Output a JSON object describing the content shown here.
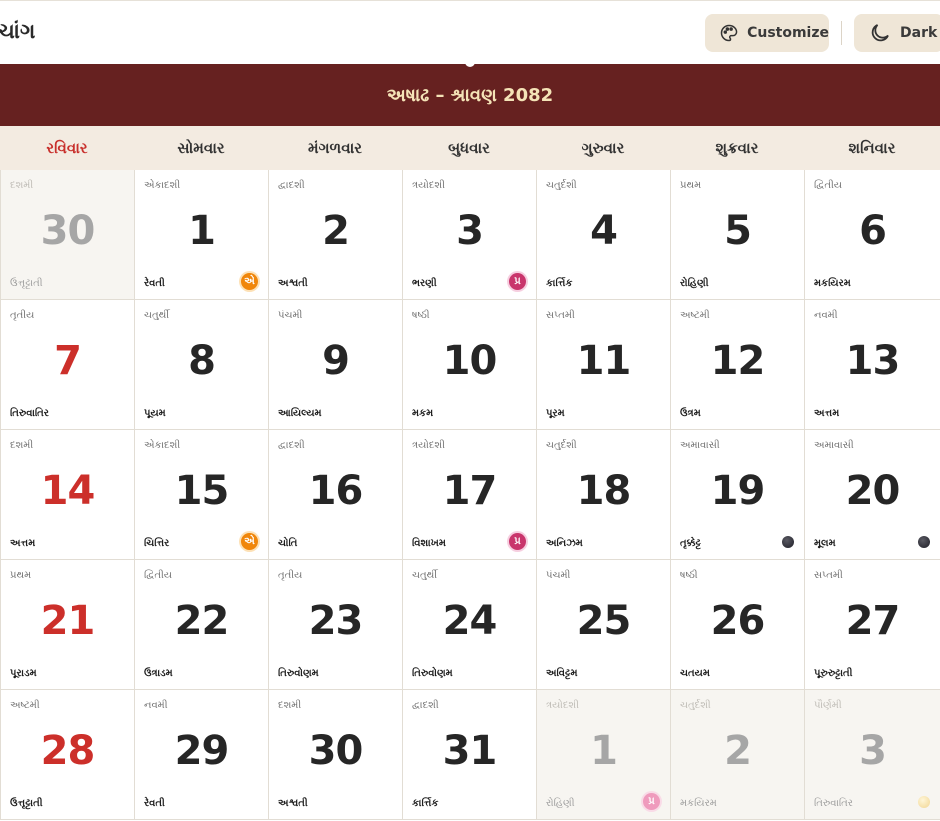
{
  "header": {
    "title": "ચાંગ",
    "customize_label": "Customize",
    "dark_label": "Dark"
  },
  "month": {
    "title": "અષાઢ – શ્રાવણ 2082"
  },
  "weekdays": [
    "રવિવાર",
    "સોમવાર",
    "મંગળવાર",
    "બુધવાર",
    "ગુરુવાર",
    "શુક્રવાર",
    "શનિવાર"
  ],
  "weeks": [
    [
      {
        "day": "30",
        "tithi": "દશમી",
        "nakshatra": "ઉત્તૃટ્ટાતી",
        "muted": true
      },
      {
        "day": "1",
        "tithi": "એકાદશી",
        "nakshatra": "રેવતી",
        "badge": "એ"
      },
      {
        "day": "2",
        "tithi": "દ્વાદશી",
        "nakshatra": "અશ્વતી"
      },
      {
        "day": "3",
        "tithi": "ત્રયોદશી",
        "nakshatra": "ભરણી",
        "badge": "પ્ર"
      },
      {
        "day": "4",
        "tithi": "ચતુર્દશી",
        "nakshatra": "કાર્ત્તિક"
      },
      {
        "day": "5",
        "tithi": "પ્રથમ",
        "nakshatra": "રોહિણી"
      },
      {
        "day": "6",
        "tithi": "દ્વિતીય",
        "nakshatra": "મકયિરમ"
      }
    ],
    [
      {
        "day": "7",
        "tithi": "તૃતીય",
        "nakshatra": "તિરુવાતિર",
        "red": true
      },
      {
        "day": "8",
        "tithi": "ચતુર્થી",
        "nakshatra": "પૂયમ"
      },
      {
        "day": "9",
        "tithi": "પંચમી",
        "nakshatra": "આયિલ્યમ"
      },
      {
        "day": "10",
        "tithi": "ષષ્ઠી",
        "nakshatra": "મકમ"
      },
      {
        "day": "11",
        "tithi": "સપ્તમી",
        "nakshatra": "પૂરમ"
      },
      {
        "day": "12",
        "tithi": "અષ્ટમી",
        "nakshatra": "ઉત્રમ"
      },
      {
        "day": "13",
        "tithi": "નવમી",
        "nakshatra": "અત્તમ"
      }
    ],
    [
      {
        "day": "14",
        "tithi": "દશમી",
        "nakshatra": "અત્તમ",
        "red": true
      },
      {
        "day": "15",
        "tithi": "એકાદશી",
        "nakshatra": "ચિત્તિર",
        "badge": "એ"
      },
      {
        "day": "16",
        "tithi": "દ્વાદશી",
        "nakshatra": "ચોતિ"
      },
      {
        "day": "17",
        "tithi": "ત્રયોદશી",
        "nakshatra": "વિશાખમ",
        "badge": "પ્ર"
      },
      {
        "day": "18",
        "tithi": "ચતુર્દશી",
        "nakshatra": "અનિઝમ"
      },
      {
        "day": "19",
        "tithi": "અમાવાસી",
        "nakshatra": "તૃક્કેટ્ટ",
        "moon": "new"
      },
      {
        "day": "20",
        "tithi": "અમાવાસી",
        "nakshatra": "મૂલમ",
        "moon": "new"
      }
    ],
    [
      {
        "day": "21",
        "tithi": "પ્રથમ",
        "nakshatra": "પૂરાડમ",
        "red": true
      },
      {
        "day": "22",
        "tithi": "દ્વિતીય",
        "nakshatra": "ઉત્રાડમ"
      },
      {
        "day": "23",
        "tithi": "તૃતીય",
        "nakshatra": "તિરુવોણમ"
      },
      {
        "day": "24",
        "tithi": "ચતુર્થી",
        "nakshatra": "તિરુવોણમ"
      },
      {
        "day": "25",
        "tithi": "પંચમી",
        "nakshatra": "અવિટ્ટમ"
      },
      {
        "day": "26",
        "tithi": "ષષ્ઠી",
        "nakshatra": "ચતયમ"
      },
      {
        "day": "27",
        "tithi": "સપ્તમી",
        "nakshatra": "પૂરુરુટ્ટાતી"
      }
    ],
    [
      {
        "day": "28",
        "tithi": "અષ્ટમી",
        "nakshatra": "ઉત્તૃટ્ટાતી",
        "red": true
      },
      {
        "day": "29",
        "tithi": "નવમી",
        "nakshatra": "રેવતી"
      },
      {
        "day": "30",
        "tithi": "દશમી",
        "nakshatra": "અશ્વતી"
      },
      {
        "day": "31",
        "tithi": "દ્વાદશી",
        "nakshatra": "કાર્ત્તિક"
      },
      {
        "day": "1",
        "tithi": "ત્રયોદશી",
        "nakshatra": "રોહિણી",
        "muted": true,
        "badge": "પ્ર"
      },
      {
        "day": "2",
        "tithi": "ચતુર્દશી",
        "nakshatra": "મકયિરમ",
        "muted": true
      },
      {
        "day": "3",
        "tithi": "પૌર્ણમી",
        "nakshatra": "તિરુવાતિર",
        "muted": true,
        "moon": "full"
      }
    ]
  ]
}
